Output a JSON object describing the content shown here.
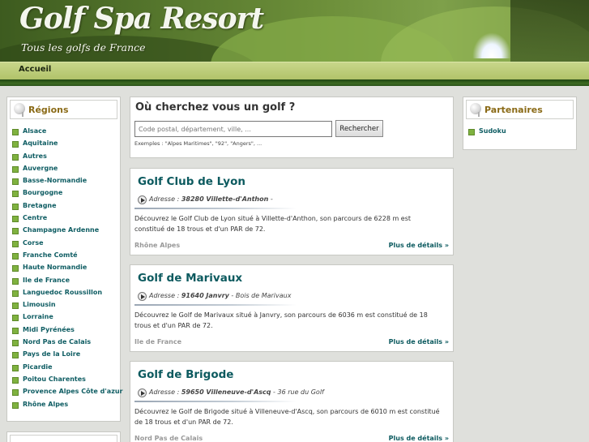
{
  "header": {
    "title": "Golf Spa Resort",
    "tagline": "Tous les golfs de France"
  },
  "nav": {
    "home": "Accueil"
  },
  "sidebar": {
    "regions_title": "Régions",
    "regions": [
      "Alsace",
      "Aquitaine",
      "Autres",
      "Auvergne",
      "Basse-Normandie",
      "Bourgogne",
      "Bretagne",
      "Centre",
      "Champagne Ardenne",
      "Corse",
      "Franche Comté",
      "Haute Normandie",
      "Ile de France",
      "Languedoc Roussillon",
      "Limousin",
      "Lorraine",
      "Midi Pyrénées",
      "Nord Pas de Calais",
      "Pays de la Loire",
      "Picardie",
      "Poitou Charentes",
      "Provence Alpes Côte d'azur",
      "Rhône Alpes"
    ]
  },
  "partners": {
    "title": "Partenaires",
    "items": [
      "Sudoku"
    ]
  },
  "search": {
    "title": "Où cherchez vous un golf ?",
    "placeholder": "Code postal, département, ville, ...",
    "button": "Rechercher",
    "examples": "Exemples : \"Alpes Maritimes\", \"92\", \"Angers\", ..."
  },
  "golfs": [
    {
      "name": "Golf Club de Lyon",
      "address_label": "Adresse :",
      "address_main": "38280 Villette-d'Anthon",
      "address_extra": " -",
      "description": "Découvrez le Golf Club de Lyon situé à Villette-d'Anthon, son parcours de 6228 m est constitué de 18 trous et d'un PAR de 72.",
      "region": "Rhône Alpes",
      "more": "Plus de détails »"
    },
    {
      "name": "Golf de Marivaux",
      "address_label": "Adresse :",
      "address_main": "91640 Janvry",
      "address_extra": " - Bois de Marivaux",
      "description": "Découvrez le Golf de Marivaux situé à Janvry, son parcours de 6036 m est constitué de 18 trous et d'un PAR de 72.",
      "region": "Ile de France",
      "more": "Plus de détails »"
    },
    {
      "name": "Golf de Brigode",
      "address_label": "Adresse :",
      "address_main": "59650 Villeneuve-d'Ascq",
      "address_extra": " - 36 rue du Golf",
      "description": "Découvrez le Golf de Brigode situé à Villeneuve-d'Ascq, son parcours de 6010 m est constitué de 18 trous et d'un PAR de 72.",
      "region": "Nord Pas de Calais",
      "more": "Plus de détails »"
    }
  ]
}
